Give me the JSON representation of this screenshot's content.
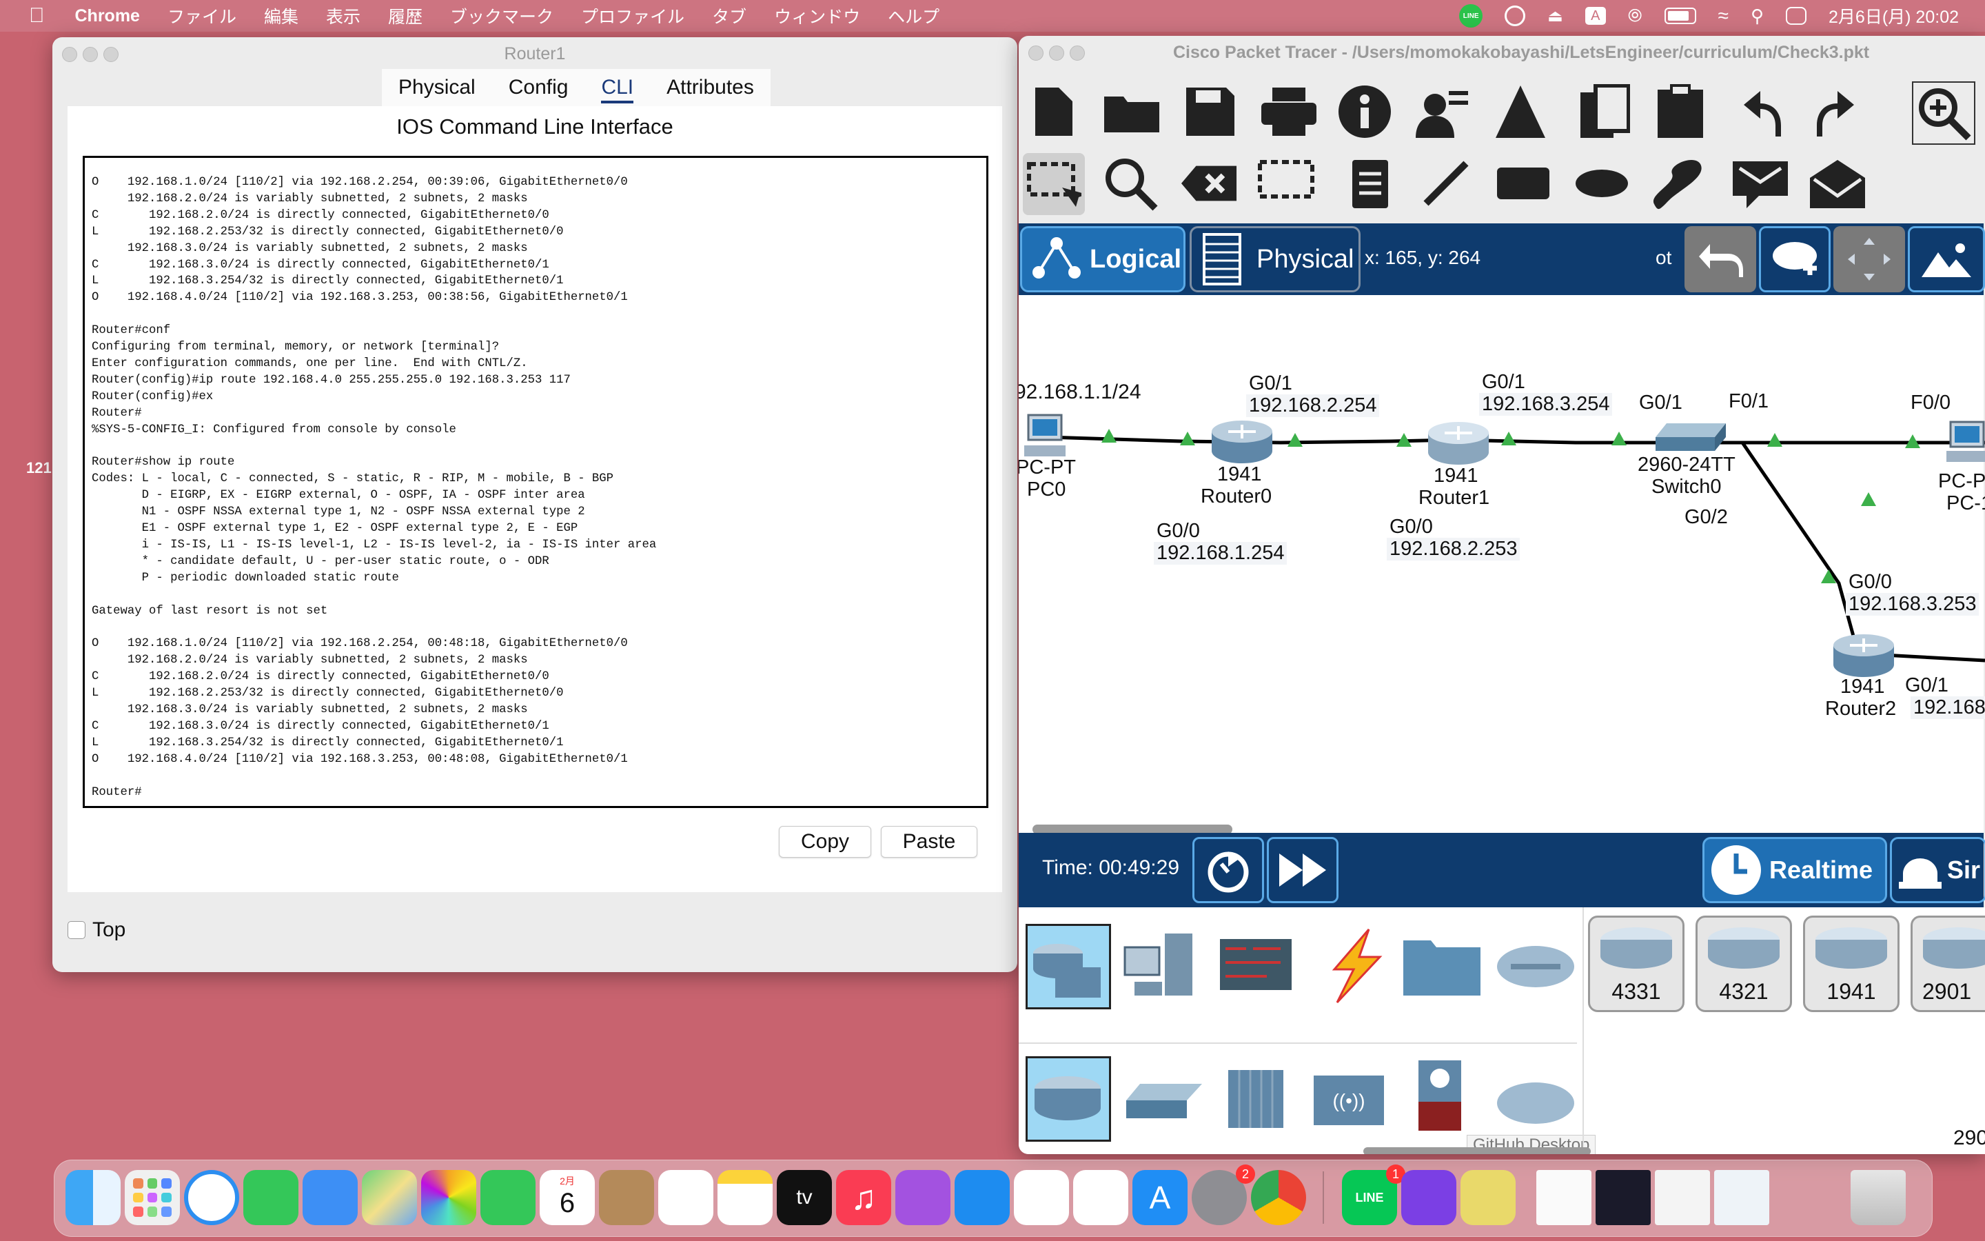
{
  "menubar": {
    "apple": "",
    "app": "Chrome",
    "items": [
      "ファイル",
      "編集",
      "表示",
      "履歴",
      "ブックマーク",
      "プロファイル",
      "タブ",
      "ウィンドウ",
      "ヘルプ"
    ],
    "clock": "2月6日(月) 20:02",
    "input_mode": "A",
    "line_badge": "LINE"
  },
  "router_window": {
    "title": "Router1",
    "tabs": [
      "Physical",
      "Config",
      "CLI",
      "Attributes"
    ],
    "selected_tab": "CLI",
    "heading": "IOS Command Line Interface",
    "terminal_lines": [
      "O    192.168.1.0/24 [110/2] via 192.168.2.254, 00:39:06, GigabitEthernet0/0",
      "     192.168.2.0/24 is variably subnetted, 2 subnets, 2 masks",
      "C       192.168.2.0/24 is directly connected, GigabitEthernet0/0",
      "L       192.168.2.253/32 is directly connected, GigabitEthernet0/0",
      "     192.168.3.0/24 is variably subnetted, 2 subnets, 2 masks",
      "C       192.168.3.0/24 is directly connected, GigabitEthernet0/1",
      "L       192.168.3.254/32 is directly connected, GigabitEthernet0/1",
      "O    192.168.4.0/24 [110/2] via 192.168.3.253, 00:38:56, GigabitEthernet0/1",
      "",
      "Router#conf",
      "Configuring from terminal, memory, or network [terminal]?",
      "Enter configuration commands, one per line.  End with CNTL/Z.",
      "Router(config)#ip route 192.168.4.0 255.255.255.0 192.168.3.253 117",
      "Router(config)#ex",
      "Router#",
      "%SYS-5-CONFIG_I: Configured from console by console",
      "",
      "Router#show ip route",
      "Codes: L - local, C - connected, S - static, R - RIP, M - mobile, B - BGP",
      "       D - EIGRP, EX - EIGRP external, O - OSPF, IA - OSPF inter area",
      "       N1 - OSPF NSSA external type 1, N2 - OSPF NSSA external type 2",
      "       E1 - OSPF external type 1, E2 - OSPF external type 2, E - EGP",
      "       i - IS-IS, L1 - IS-IS level-1, L2 - IS-IS level-2, ia - IS-IS inter area",
      "       * - candidate default, U - per-user static route, o - ODR",
      "       P - periodic downloaded static route",
      "",
      "Gateway of last resort is not set",
      "",
      "O    192.168.1.0/24 [110/2] via 192.168.2.254, 00:48:18, GigabitEthernet0/0",
      "     192.168.2.0/24 is variably subnetted, 2 subnets, 2 masks",
      "C       192.168.2.0/24 is directly connected, GigabitEthernet0/0",
      "L       192.168.2.253/32 is directly connected, GigabitEthernet0/0",
      "     192.168.3.0/24 is variably subnetted, 2 subnets, 2 masks",
      "C       192.168.3.0/24 is directly connected, GigabitEthernet0/1",
      "L       192.168.3.254/32 is directly connected, GigabitEthernet0/1",
      "O    192.168.4.0/24 [110/2] via 192.168.3.253, 00:48:08, GigabitEthernet0/1",
      "",
      "Router#"
    ],
    "copy_label": "Copy",
    "paste_label": "Paste",
    "top_label": "Top"
  },
  "desktop_label": "121",
  "packet_tracer": {
    "title": "Cisco Packet Tracer - /Users/momokakobayashi/LetsEngineer/curriculum/Check3.pkt",
    "logical_label": "Logical",
    "physical_label": "Physical",
    "coords": "x: 165, y: 264",
    "root_label": "ot",
    "time_label": "Time: 00:49:29",
    "realtime_label": "Realtime",
    "sim_label": "Sir",
    "tooltip": "GitHub Desktop",
    "bottom_partial": "290",
    "device_models": [
      "4331",
      "4321",
      "1941",
      "2901"
    ],
    "topology": {
      "pc0_ip": "92.168.1.1/24",
      "pc0_type": "PC-PT",
      "pc0_name": "PC0",
      "r0_model": "1941",
      "r0_name": "Router0",
      "r0_g01": "G0/1",
      "r0_g01_ip": "192.168.2.254",
      "r0_g00": "G0/0",
      "r0_g00_ip": "192.168.1.254",
      "r1_model": "1941",
      "r1_name": "Router1",
      "r1_g01": "G0/1",
      "r1_g01_ip": "192.168.3.254",
      "r1_g00": "G0/0",
      "r1_g00_ip": "192.168.2.253",
      "sw_model": "2960-24TT",
      "sw_name": "Switch0",
      "sw_g01": "G0/1",
      "sw_f01": "F0/1",
      "sw_g02": "G0/2",
      "pc1_f00": "F0/0",
      "pc1_type": "PC-P",
      "pc1_name": "PC-1",
      "r2_model": "1941",
      "r2_name": "Router2",
      "r2_g00": "G0/0",
      "r2_g00_ip": "192.168.3.253",
      "r2_g01": "G0/1",
      "r2_g01_ip": "192.168"
    }
  },
  "dock": {
    "calendar_month": "2月",
    "calendar_day": "6",
    "badge_settings": "2",
    "badge_line": "1",
    "tv_label": "tv",
    "line_label": "LINE"
  }
}
